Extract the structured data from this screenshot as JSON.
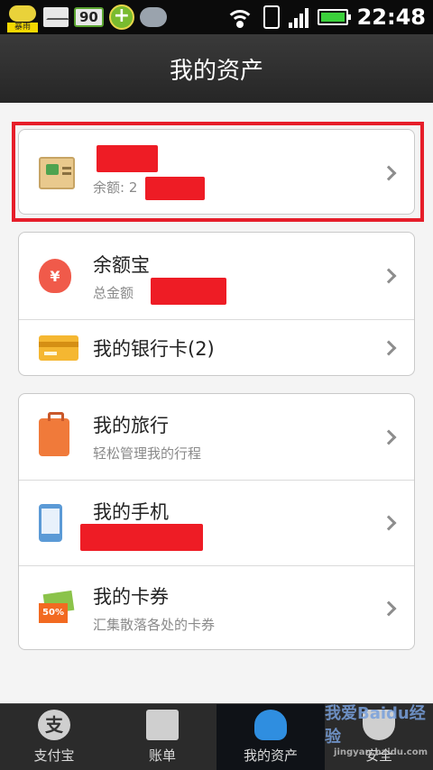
{
  "status_bar": {
    "weather_label": "暴雨",
    "badge": "90",
    "time": "22:48"
  },
  "header": {
    "title": "我的资产"
  },
  "account_card": {
    "balance_label": "余额: 2"
  },
  "finance_card": {
    "items": [
      {
        "title": "余额宝",
        "subtitle": "总金额"
      },
      {
        "title": "我的银行卡(2)"
      }
    ]
  },
  "services_card": {
    "items": [
      {
        "title": "我的旅行",
        "subtitle": "轻松管理我的行程"
      },
      {
        "title": "我的手机"
      },
      {
        "title": "我的卡券",
        "subtitle": "汇集散落各处的卡券",
        "icon_text": "50%"
      }
    ]
  },
  "tabbar": {
    "tabs": [
      {
        "label": "支付宝",
        "icon_text": "支"
      },
      {
        "label": "账单"
      },
      {
        "label": "我的资产"
      },
      {
        "label": "安全"
      }
    ],
    "watermark": "我爱Baidu经验",
    "watermark_url": "jingyan.baidu.com"
  },
  "colors": {
    "highlight": "#e61e2a",
    "redaction": "#ee1c25"
  }
}
